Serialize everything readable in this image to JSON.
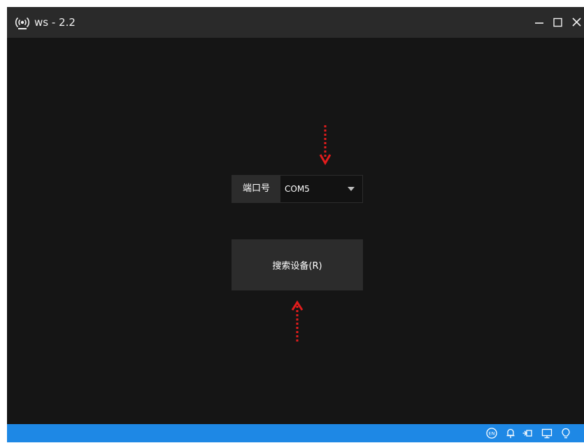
{
  "window": {
    "title": "ws - 2.2"
  },
  "form": {
    "port_label": "端口号",
    "port_value": "COM5",
    "search_button_label": "搜索设备(R)"
  },
  "statusbar": {
    "language_badge": "EN",
    "icons": [
      "language-icon",
      "bell-icon",
      "pin-icon",
      "monitor-icon",
      "bulb-icon"
    ]
  },
  "colors": {
    "background": "#151515",
    "titlebar": "#2a2a2a",
    "panel": "#2c2c2c",
    "statusbar": "#1e88e5",
    "annotation_arrow": "#e21c1c"
  }
}
